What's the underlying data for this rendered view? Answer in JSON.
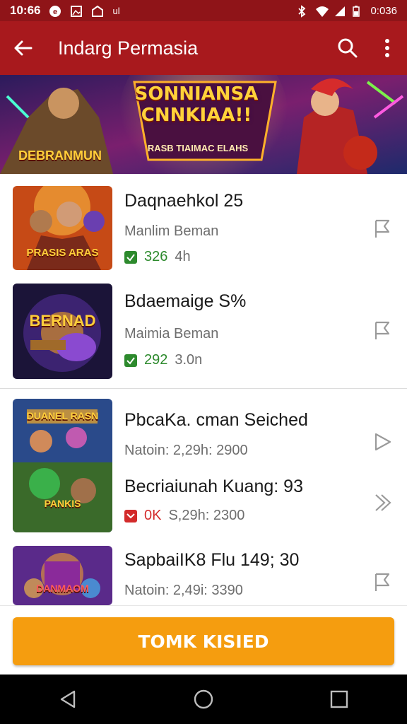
{
  "status_bar": {
    "time": "10:66",
    "battery_text": "0:036",
    "signal_label": "ul"
  },
  "app_bar": {
    "title": "Indarg Permasia",
    "icons": [
      "back-arrow-icon",
      "search-icon",
      "more-vert-icon"
    ]
  },
  "banner": {
    "title": "SONNIANSA CNNKIAA!!",
    "subtitle": "RASB TIAIMAC ELAHS",
    "left_caption": "DEBRANMUN"
  },
  "items": [
    {
      "title": "Daqnaehkol 25",
      "subtitle": "Manlim Beman",
      "meta_value": "326",
      "meta_extra": "4h",
      "status": "checked",
      "thumb_caption": "PRASIS ARAS"
    },
    {
      "title": "Bdaemaige S%",
      "subtitle": "Maimia Beman",
      "meta_value": "292",
      "meta_extra": "3.0n",
      "status": "checked",
      "thumb_caption": "BERNAD"
    },
    {
      "title": "PbcaKa. cman Seiched",
      "subtitle": "Natoin: 2,29h: 2900",
      "status": "none",
      "thumb_caption": "DUANEL RASN"
    },
    {
      "title": "Becriaiunah Kuang: 93",
      "subtitle": "",
      "meta_value": "0K",
      "meta_extra": "S,29h: 2300",
      "status": "flagged",
      "thumb_caption": "PANKIS"
    },
    {
      "title": "SapbaiIK8 Flu 149; 30",
      "subtitle": "Natoin: 2,49i: 3390",
      "status": "none",
      "thumb_caption": "DANMAOM"
    }
  ],
  "cta": {
    "label": "TOMK KISIED"
  },
  "nav": {
    "icons": [
      "back-triangle-icon",
      "home-circle-icon",
      "recents-square-icon"
    ]
  },
  "colors": {
    "primary": "#a8191d",
    "accent": "#f59d0f",
    "check_green": "#2d8a2d",
    "red": "#d32b2b"
  }
}
